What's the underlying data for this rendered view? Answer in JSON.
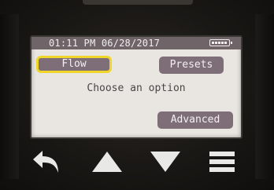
{
  "status_bar": {
    "datetime": "01:11 PM 06/28/2017",
    "battery_icon": "battery-icon"
  },
  "buttons": {
    "flow_label": "Flow",
    "presets_label": "Presets",
    "advanced_label": "Advanced"
  },
  "prompt": "Choose an option",
  "nav_keys": {
    "back": "back-arrow-icon",
    "up": "up-triangle-icon",
    "down": "down-triangle-icon",
    "menu": "hamburger-menu-icon"
  },
  "colors": {
    "status_bar": "#6f6468",
    "button": "#7e6e78",
    "focus_outline": "#f0d52a",
    "screen_bg": "#e9e6e1",
    "nav_key": "#e8e8e6"
  }
}
